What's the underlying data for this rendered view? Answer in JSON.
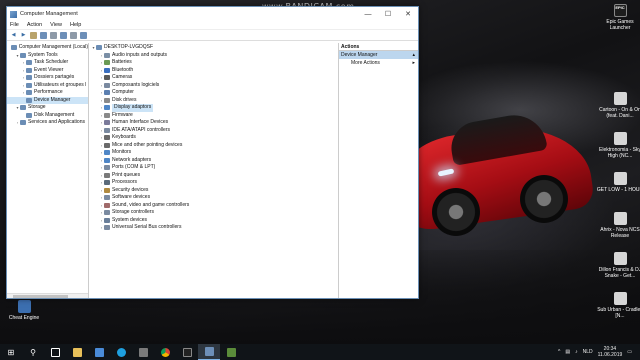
{
  "overlay": {
    "watermark": "www.BANDICAM.com"
  },
  "window": {
    "title": "Computer Management",
    "controls": {
      "minimize": "—",
      "maximize": "☐",
      "close": "✕"
    },
    "menu": [
      "File",
      "Action",
      "View",
      "Help"
    ],
    "left_tree": [
      {
        "label": "Computer Management (Local)",
        "indent": 0,
        "arrow": "",
        "selected": false
      },
      {
        "label": "System Tools",
        "indent": 1,
        "arrow": "▾",
        "selected": false
      },
      {
        "label": "Task Scheduler",
        "indent": 2,
        "arrow": "›",
        "selected": false
      },
      {
        "label": "Event Viewer",
        "indent": 2,
        "arrow": "›",
        "selected": false
      },
      {
        "label": "Dossiers partagés",
        "indent": 2,
        "arrow": "›",
        "selected": false
      },
      {
        "label": "Utilisateurs et groupes l",
        "indent": 2,
        "arrow": "›",
        "selected": false
      },
      {
        "label": "Performance",
        "indent": 2,
        "arrow": "›",
        "selected": false
      },
      {
        "label": "Device Manager",
        "indent": 2,
        "arrow": "",
        "selected": true
      },
      {
        "label": "Storage",
        "indent": 1,
        "arrow": "▾",
        "selected": false
      },
      {
        "label": "Disk Management",
        "indent": 2,
        "arrow": "",
        "selected": false
      },
      {
        "label": "Services and Applications",
        "indent": 1,
        "arrow": "›",
        "selected": false
      }
    ],
    "device_root": "DESKTOP-LVGDQSF",
    "devices": [
      "Audio inputs and outputs",
      "Batteries",
      "Bluetooth",
      "Cameras",
      "Composants logiciels",
      "Computer",
      "Disk drives",
      "Display adaptors",
      "Firmware",
      "Human Interface Devices",
      "IDE ATA/ATAPI controllers",
      "Keyboards",
      "Mice and other pointing devices",
      "Monitors",
      "Network adapters",
      "Ports (COM & LPT)",
      "Print queues",
      "Processors",
      "Security devices",
      "Software devices",
      "Sound, video and game controllers",
      "Storage controllers",
      "System devices",
      "Universal Serial Bus controllers"
    ],
    "selected_device": "Display adaptors",
    "actions": {
      "header": "Actions",
      "section": "Device Manager",
      "section_arrow": "▴",
      "more": "More Actions",
      "more_arrow": "▸"
    }
  },
  "desktop_icons": {
    "cheat_engine": "Cheat Engine",
    "epic": "Epic Games Launcher",
    "epic_badge": "EPIC",
    "right_column": [
      "Cartoon - On & On (feat. Dani...",
      "Elektronomia - Sky High (NC...",
      "GET LOW - 1 HOUR",
      "Ahrix - Nova NCS Release",
      "Dillon Francis & DJ Snake - Get...",
      "Sub Urban - Cradles [N..."
    ]
  },
  "taskbar": {
    "start": "⊞",
    "search": "⚲",
    "language": "NLD",
    "time": "20:34",
    "date": "11.06.2019",
    "tray_chevron": "^"
  }
}
